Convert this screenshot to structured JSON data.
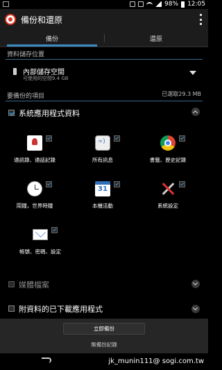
{
  "status_bar": {
    "battery_percent": "98%",
    "time": "12:05"
  },
  "action_bar": {
    "title": "備份和還原",
    "app_icon": "backup-restore-icon",
    "overflow_icon": "overflow-menu-icon"
  },
  "tabs": [
    {
      "label": "備份",
      "active": true
    },
    {
      "label": "還原",
      "active": false
    }
  ],
  "storage_section": {
    "label": "資料儲存位置",
    "selected": "內部儲存空間",
    "available": "可使用的空間9.4 GB"
  },
  "items_section": {
    "label": "要備份的項目",
    "selected_size": "已選取29.3 MB"
  },
  "groups": {
    "system_apps": {
      "label": "系統應用程式資料",
      "checked": true,
      "expanded": true
    },
    "media": {
      "label": "媒體檔案",
      "checked": false,
      "expanded": false
    },
    "downloaded_apps": {
      "label": "附資料的已下載應用程式",
      "checked": false,
      "expanded": false
    }
  },
  "app_items": [
    {
      "label": "通訊錄、通話記錄",
      "icon": "contacts-icon",
      "checked": true
    },
    {
      "label": "所有訊息",
      "icon": "messaging-icon",
      "checked": true
    },
    {
      "label": "書籤、歷史記錄",
      "icon": "chrome-icon",
      "checked": true
    },
    {
      "label": "鬧鐘，世界時鐘",
      "icon": "clock-icon",
      "checked": true
    },
    {
      "label": "本機活動",
      "icon": "calendar-icon",
      "checked": true
    },
    {
      "label": "系統設定",
      "icon": "settings-tools-icon",
      "checked": true
    },
    {
      "label": "帳號、密碼、設定",
      "icon": "email-icon",
      "checked": true
    }
  ],
  "bottom": {
    "backup_now": "立即備份",
    "no_records": "無備份記錄"
  },
  "watermark": "jk_munin111@ sogi.com.tw",
  "colors": {
    "accent": "#3b8ac4",
    "background": "#000000",
    "action_bar": "#1c1c1c"
  }
}
